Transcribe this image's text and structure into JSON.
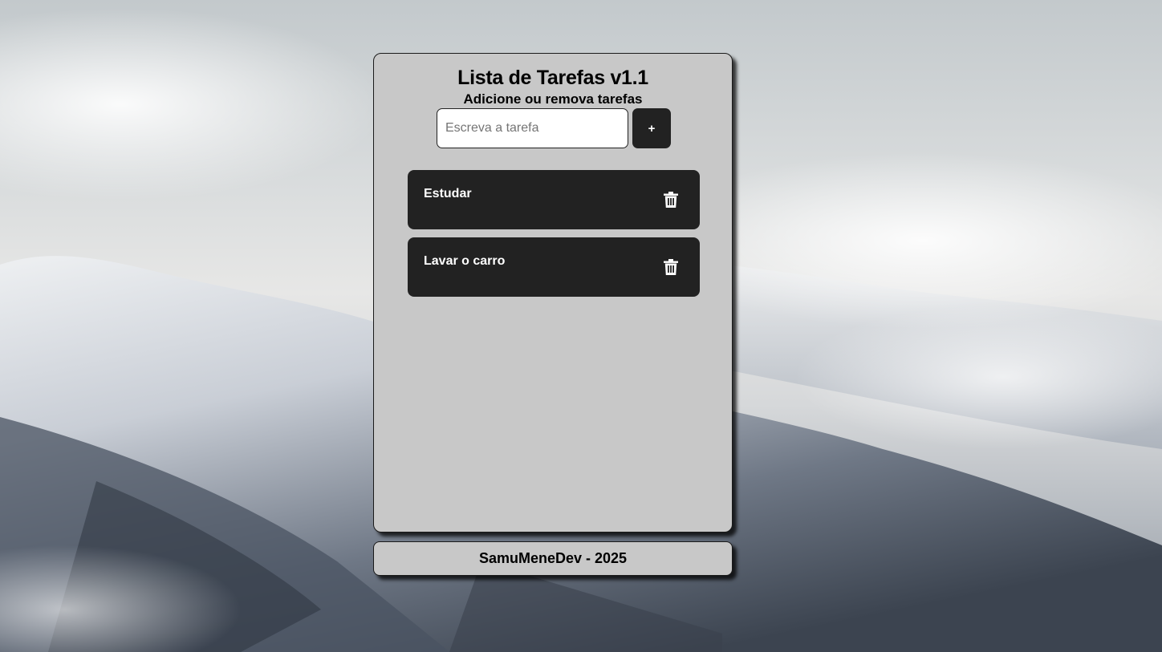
{
  "app": {
    "title": "Lista de Tarefas v1.1",
    "subtitle": "Adicione ou remova tarefas"
  },
  "input": {
    "placeholder": "Escreva a tarefa",
    "value": ""
  },
  "add_button": {
    "label": "+"
  },
  "tasks": [
    {
      "label": "Estudar",
      "icon": "trash-icon"
    },
    {
      "label": "Lavar o carro",
      "icon": "trash-icon"
    }
  ],
  "footer": {
    "text": "SamuMeneDev - 2025"
  },
  "colors": {
    "card_background": "#c8c8c8",
    "task_background": "#222222",
    "button_background": "#222222",
    "text_dark": "#000000",
    "text_light": "#ffffff"
  }
}
